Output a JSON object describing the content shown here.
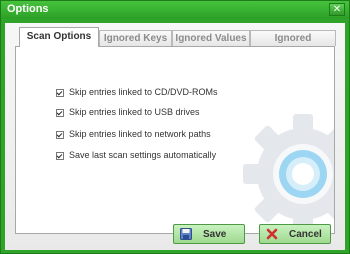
{
  "window": {
    "title": "Options",
    "close_symbol": "✕"
  },
  "tabs": [
    {
      "label": "Scan Options",
      "active": true
    },
    {
      "label": "Ignored Keys",
      "active": false
    },
    {
      "label": "Ignored Values",
      "active": false
    },
    {
      "label": "Ignored Shortcuts",
      "active": false
    }
  ],
  "options": [
    {
      "label": "Skip entries linked to CD/DVD-ROMs",
      "checked": true
    },
    {
      "label": "Skip entries linked to USB drives",
      "checked": true
    },
    {
      "label": "Skip entries linked to network paths",
      "checked": true
    },
    {
      "label": "Save last scan settings automatically",
      "checked": true
    }
  ],
  "buttons": {
    "save": {
      "label": "Save",
      "icon": "disk-icon"
    },
    "cancel": {
      "label": "Cancel",
      "icon": "red-x-icon"
    }
  },
  "colors": {
    "frame": "#2fa32a",
    "button_fill": "#b4e6a8",
    "cancel_icon": "#d22e2e"
  }
}
